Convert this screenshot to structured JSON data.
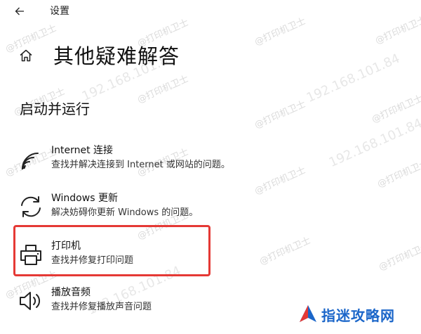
{
  "window": {
    "title": "设置"
  },
  "header": {
    "page_title": "其他疑难解答"
  },
  "section": {
    "title": "启动并运行"
  },
  "items": [
    {
      "title": "Internet 连接",
      "description": "查找并解决连接到 Internet 或网站的问题。",
      "icon": "wifi-icon"
    },
    {
      "title": "Windows 更新",
      "description": "解决妨碍你更新 Windows 的问题。",
      "icon": "sync-icon"
    },
    {
      "title": "打印机",
      "description": "查找并修复打印问题",
      "icon": "printer-icon"
    },
    {
      "title": "播放音频",
      "description": "查找并修复播放声音问题",
      "icon": "speaker-icon"
    }
  ],
  "highlight": {
    "color": "#e53935"
  },
  "watermark": {
    "text": "@打印机卫士",
    "ip_text": "192.168.101.84"
  },
  "logo": {
    "text": "指迷攻略网",
    "color": "#1b66c9"
  }
}
